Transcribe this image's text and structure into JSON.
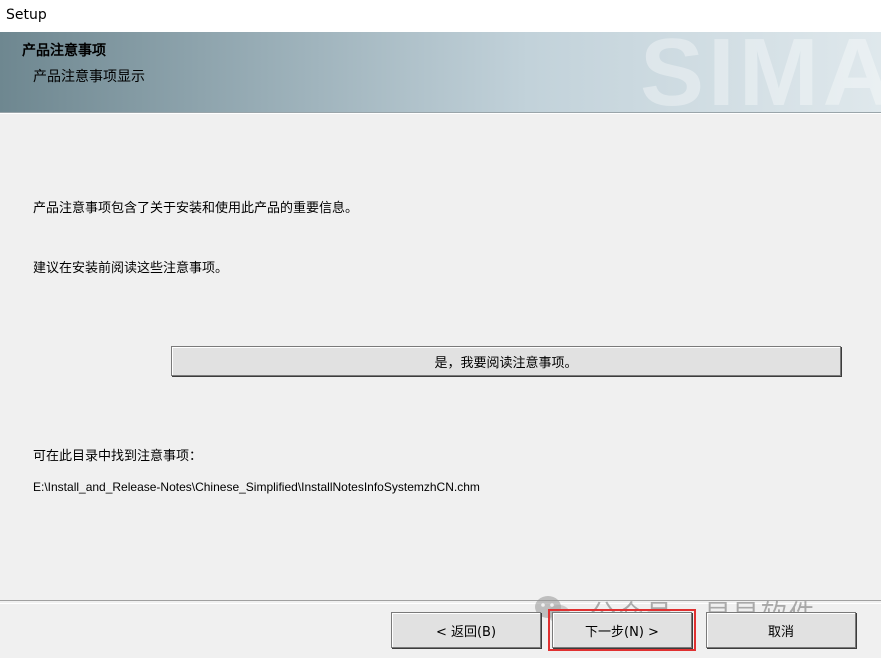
{
  "window": {
    "title": "Setup"
  },
  "banner": {
    "heading": "产品注意事项",
    "subheading": "产品注意事项显示",
    "watermark": "SIMA"
  },
  "content": {
    "paragraph1": "产品注意事项包含了关于安装和使用此产品的重要信息。",
    "paragraph2": "建议在安装前阅读这些注意事项。",
    "read_notes_button": "是，我要阅读注意事项。",
    "location_label": "可在此目录中找到注意事项：",
    "location_path": "E:\\Install_and_Release-Notes\\Chinese_Simplified\\InstallNotesInfoSystemzhCN.chm"
  },
  "footer": {
    "back_label": "< 返回(B)",
    "next_label": "下一步(N) >",
    "cancel_label": "取消"
  },
  "overlay": {
    "wechat_watermark": "公众号 · 早早软件",
    "highlight_color": "#e03131"
  }
}
